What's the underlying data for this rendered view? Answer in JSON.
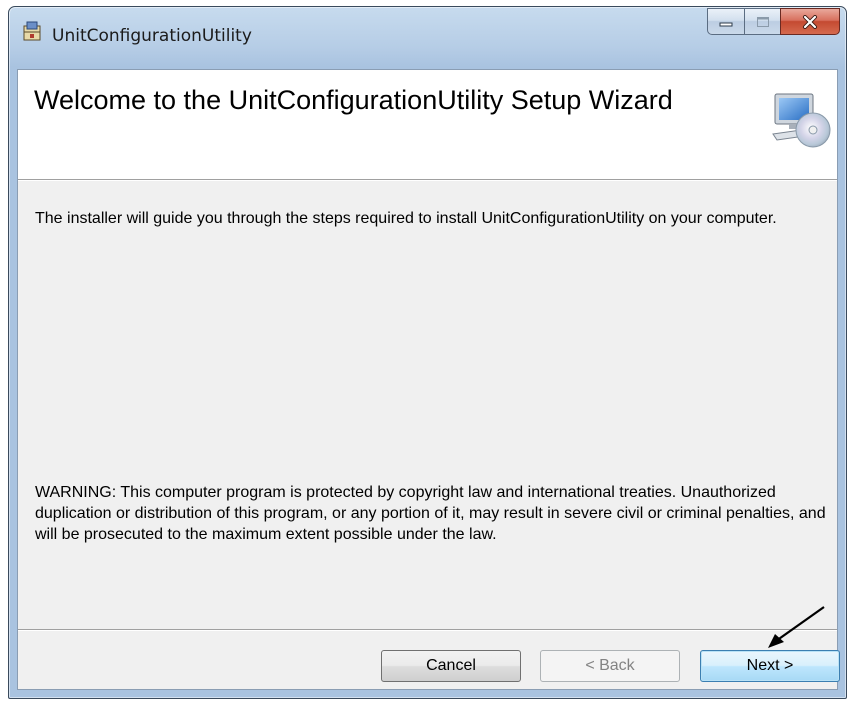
{
  "window": {
    "title": "UnitConfigurationUtility",
    "controls": [
      "minimize-icon",
      "maximize-icon",
      "close-icon"
    ]
  },
  "header": {
    "title": "Welcome to the UnitConfigurationUtility Setup Wizard",
    "image": "computer-cd-icon"
  },
  "body": {
    "intro": "The installer will guide you through the steps required to install UnitConfigurationUtility on your computer.",
    "warning": "WARNING: This computer program is protected by copyright law and international treaties. Unauthorized duplication or distribution of this program, or any portion of it, may result in severe civil or criminal penalties, and will be prosecuted to the maximum extent possible under the law."
  },
  "buttons": {
    "cancel": "Cancel",
    "back": "< Back",
    "next": "Next >"
  },
  "colors": {
    "titlebar": "#b6cde6",
    "client_bg": "#f0f0f0",
    "close_button": "#c44a31",
    "default_button_border": "#3c7fb1"
  }
}
